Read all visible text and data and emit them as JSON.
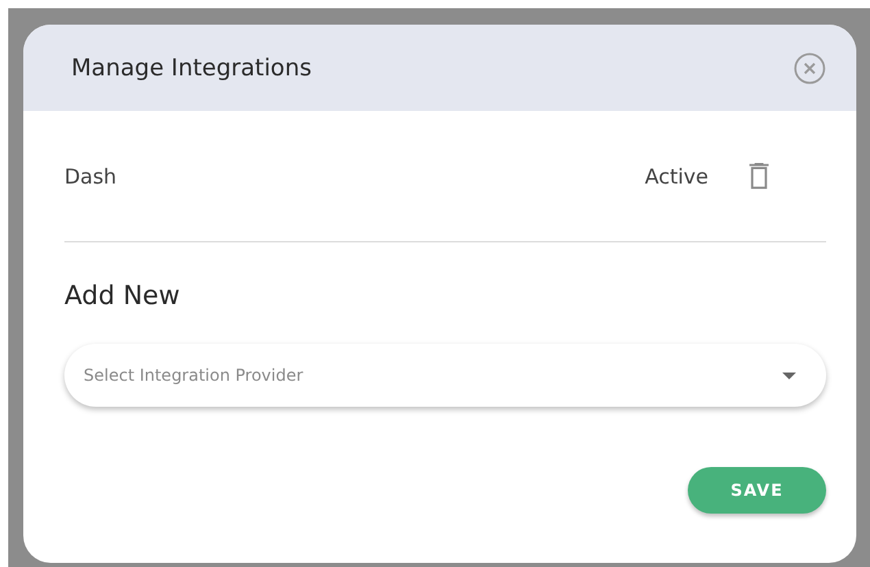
{
  "dialog": {
    "title": "Manage Integrations"
  },
  "integrations": [
    {
      "name": "Dash",
      "status": "Active"
    }
  ],
  "add_new": {
    "heading": "Add New",
    "provider_select": {
      "placeholder": "Select Integration Provider"
    }
  },
  "buttons": [
    {
      "kind": "primary",
      "label": "SAVE"
    }
  ]
}
